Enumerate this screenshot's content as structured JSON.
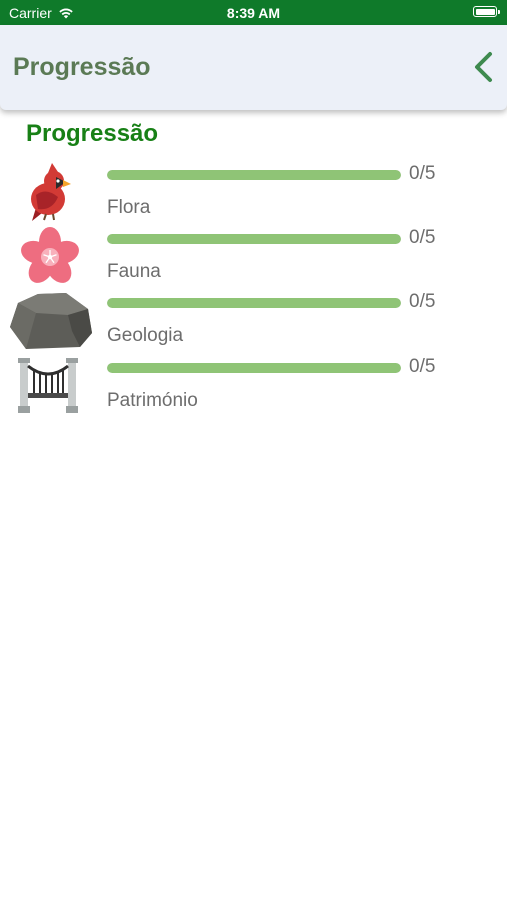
{
  "status_bar": {
    "carrier": "Carrier",
    "time": "8:39 AM",
    "icons": [
      "wifi-icon",
      "battery-icon"
    ]
  },
  "header": {
    "title": "Progressão",
    "back_icon": "chevron-left-icon"
  },
  "main": {
    "section_title": "Progressão",
    "items": [
      {
        "label": "Flora",
        "count": "0/5",
        "progress": 1.0,
        "icon": "cardinal-bird-icon"
      },
      {
        "label": "Fauna",
        "count": "0/5",
        "progress": 1.0,
        "icon": "cherry-blossom-icon"
      },
      {
        "label": "Geologia",
        "count": "0/5",
        "progress": 1.0,
        "icon": "rock-icon"
      },
      {
        "label": "Património",
        "count": "0/5",
        "progress": 1.0,
        "icon": "bridge-icon"
      }
    ]
  },
  "colors": {
    "status_bar": "#0f7a2a",
    "header_bg": "#ecf0f8",
    "header_title": "#5b7a55",
    "back_chevron": "#3e8a4f",
    "section_title": "#188016",
    "progress_fill": "#8fc476",
    "text_gray": "#6d6d6d"
  }
}
